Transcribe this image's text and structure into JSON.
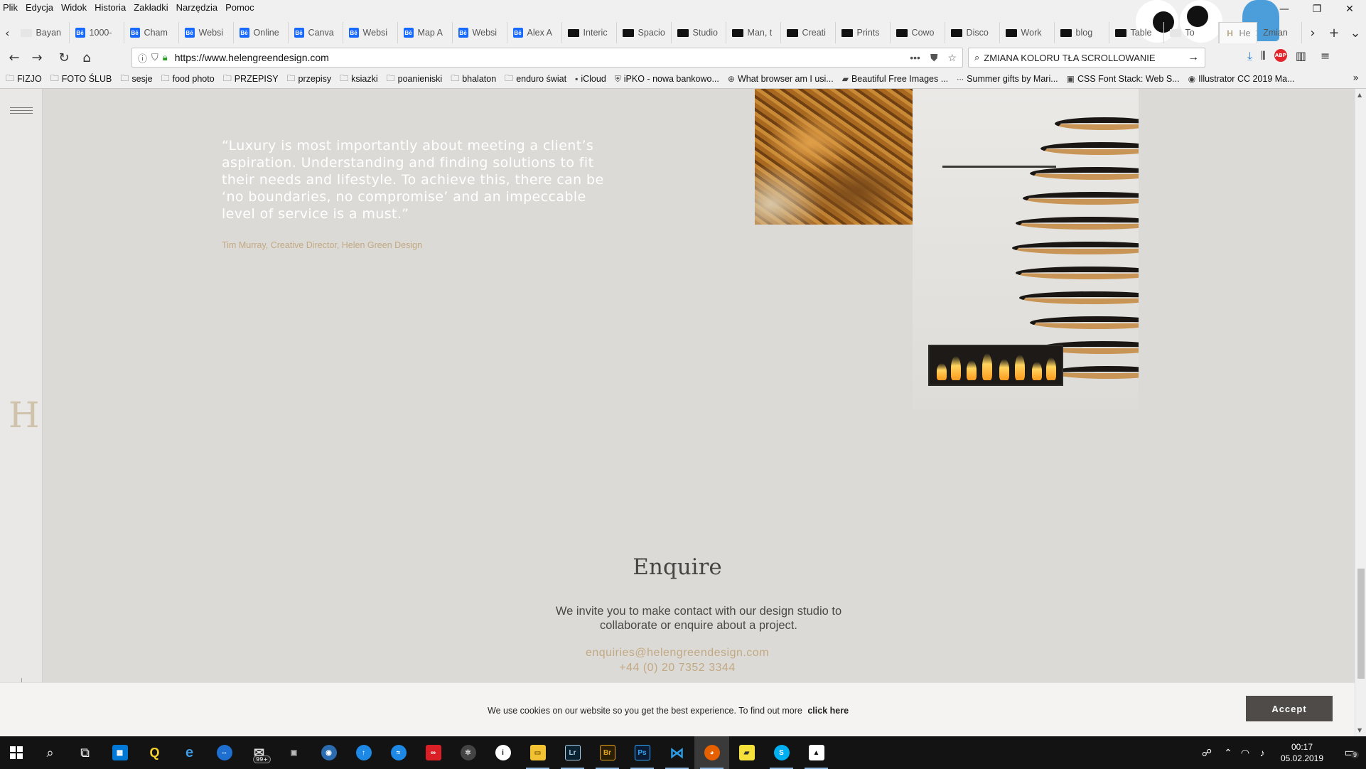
{
  "browser": {
    "menu": [
      "Plik",
      "Edycja",
      "Widok",
      "Historia",
      "Zakładki",
      "Narzędzia",
      "Pomoc"
    ],
    "tabs": [
      {
        "label": "Bayan",
        "icon": "page-icon"
      },
      {
        "label": "1000-",
        "icon": "behance-icon"
      },
      {
        "label": "Cham",
        "icon": "behance-icon"
      },
      {
        "label": "Websi",
        "icon": "behance-icon"
      },
      {
        "label": "Online",
        "icon": "behance-icon"
      },
      {
        "label": "Canva",
        "icon": "behance-icon"
      },
      {
        "label": "Websi",
        "icon": "behance-icon"
      },
      {
        "label": "Map A",
        "icon": "behance-icon"
      },
      {
        "label": "Websi",
        "icon": "behance-icon"
      },
      {
        "label": "Alex A",
        "icon": "behance-icon"
      },
      {
        "label": "Interic",
        "icon": "pinterest-icon"
      },
      {
        "label": "Spacio",
        "icon": "pinterest-icon"
      },
      {
        "label": "Studio",
        "icon": "pinterest-icon"
      },
      {
        "label": "Man, t",
        "icon": "pinterest-icon"
      },
      {
        "label": "Creati",
        "icon": "pinterest-icon"
      },
      {
        "label": "Prints",
        "icon": "pinterest-icon"
      },
      {
        "label": "Cowo",
        "icon": "pinterest-icon"
      },
      {
        "label": "Disco",
        "icon": "pinterest-icon"
      },
      {
        "label": "Work",
        "icon": "pinterest-icon"
      },
      {
        "label": "blog",
        "icon": "pinterest-icon"
      },
      {
        "label": "Table",
        "icon": "pinterest-icon"
      },
      {
        "label": "To",
        "icon": "page-icon"
      }
    ],
    "active_tab": {
      "label": "He",
      "close": "✕"
    },
    "trailing_tab": {
      "label": "Zmian"
    },
    "url": "https://www.helengreendesign.com",
    "search_query": "ZMIANA KOLORU TŁA SCROLLOWANIE",
    "bookmarks": [
      {
        "label": "FIZJO",
        "icon": "folder-icon"
      },
      {
        "label": "FOTO ŚLUB",
        "icon": "folder-icon"
      },
      {
        "label": "sesje",
        "icon": "folder-icon"
      },
      {
        "label": "food photo",
        "icon": "folder-icon"
      },
      {
        "label": "PRZEPISY",
        "icon": "folder-icon"
      },
      {
        "label": "przepisy",
        "icon": "folder-icon"
      },
      {
        "label": "ksiazki",
        "icon": "folder-icon"
      },
      {
        "label": "poanieniski",
        "icon": "folder-icon"
      },
      {
        "label": "bhalaton",
        "icon": "folder-icon"
      },
      {
        "label": "enduro świat",
        "icon": "folder-icon"
      },
      {
        "label": "iCloud",
        "icon": "apple-icon"
      },
      {
        "label": "iPKO - nowa bankowo...",
        "icon": "bank-icon"
      },
      {
        "label": "What browser am I usi...",
        "icon": "globe-icon"
      },
      {
        "label": "Beautiful Free Images ...",
        "icon": "unsplash-icon"
      },
      {
        "label": "Summer gifts by Mari...",
        "icon": "dots-icon"
      },
      {
        "label": "CSS Font Stack: Web S...",
        "icon": "css-icon"
      },
      {
        "label": "Illustrator CC 2019 Ma...",
        "icon": "adobe-icon"
      }
    ]
  },
  "site": {
    "quote": "“Luxury is most importantly about meeting a client’s aspiration. Understanding and finding solutions to fit their needs and lifestyle. To achieve this, there can be ‘no boundaries, no compromise’ and an impeccable level of service is a must.”",
    "quote_author": "Tim Murray, Creative Director, Helen Green Design",
    "logo_letter": "H",
    "enquire": {
      "title": "Enquire",
      "text": "We invite you to make contact with our design studio to collaborate or enquire about a project.",
      "email": "enquiries@helengreendesign.com",
      "phone": "+44 (0) 20 7352 3344"
    },
    "cookie": {
      "text": "We use cookies on our website so you get the best experience. To find out more",
      "link": "click here",
      "accept": "Accept"
    },
    "colors": {
      "accent": "#c2a982",
      "page_bg": "#dcdad6",
      "button": "#4e4b49"
    }
  },
  "taskbar": {
    "apps": [
      "start-icon",
      "search-icon",
      "task-view-icon",
      "store-icon",
      "qbittorrent-icon",
      "edge-icon",
      "teamviewer-icon",
      "mail-icon",
      "unknown-app-icon",
      "network-icon",
      "upload-icon",
      "messenger-icon",
      "creative-cloud-icon",
      "davinci-icon",
      "info-icon",
      "file-explorer-icon",
      "lightroom-icon",
      "bridge-icon",
      "photoshop-icon",
      "vscode-icon",
      "firefox-icon",
      "sticky-notes-icon",
      "skype-icon",
      "photos-icon"
    ],
    "labels": {
      "lightroom": "Lr",
      "bridge": "Br",
      "photoshop": "Ps"
    },
    "mail_badge": "99+",
    "time": "00:17",
    "date": "05.02.2019",
    "notifications": "9"
  }
}
